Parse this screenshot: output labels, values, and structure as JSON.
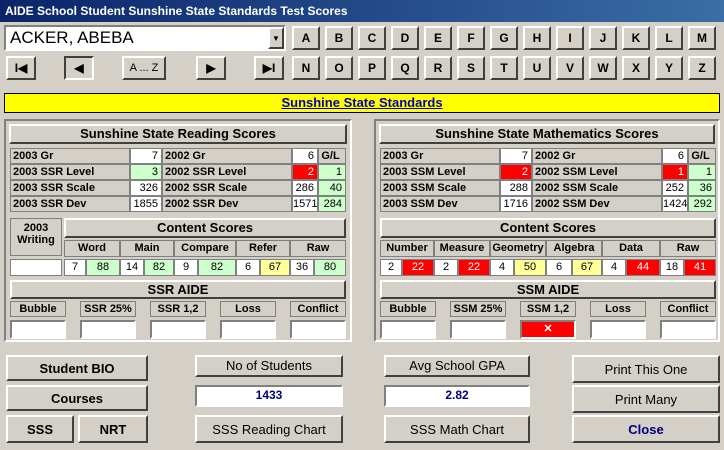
{
  "window": {
    "title": "AIDE School Student Sunshine State Standards Test Scores"
  },
  "student": {
    "name": "ACKER, ABEBA"
  },
  "letters_row1": [
    "A",
    "B",
    "C",
    "D",
    "E",
    "F",
    "G",
    "H",
    "I",
    "J",
    "K",
    "L",
    "M"
  ],
  "letters_row2": [
    "N",
    "O",
    "P",
    "Q",
    "R",
    "S",
    "T",
    "U",
    "V",
    "W",
    "X",
    "Y",
    "Z"
  ],
  "nav": {
    "first": "I◀",
    "prev": "◀",
    "range": "A ... Z",
    "next": "▶",
    "last": "▶I"
  },
  "banner": "Sunshine State Standards",
  "reading": {
    "title": "Sunshine State Reading Scores",
    "rows": [
      {
        "l1": "2003 Gr",
        "v1": "7",
        "l2": "2002 Gr",
        "v2": "6",
        "v3": "G/L"
      },
      {
        "l1": "2003 SSR Level",
        "v1": "3",
        "l2": "2002 SSR Level",
        "v2": "2",
        "v3": "1"
      },
      {
        "l1": "2003 SSR Scale",
        "v1": "326",
        "l2": "2002 SSR Scale",
        "v2": "286",
        "v3": "40"
      },
      {
        "l1": "2003 SSR Dev",
        "v1": "1855",
        "l2": "2002 SSR Dev",
        "v2": "1571",
        "v3": "284"
      }
    ],
    "writing_label": "2003 Writing",
    "content_title": "Content Scores",
    "content_cols": [
      "Word",
      "Main",
      "Compare",
      "Refer",
      "Raw"
    ],
    "content_vals": [
      "7",
      "88",
      "14",
      "82",
      "9",
      "82",
      "6",
      "67",
      "36",
      "80"
    ],
    "aide_title": "SSR AIDE",
    "aide_cols": [
      "Bubble",
      "SSR 25%",
      "SSR 1,2",
      "Loss",
      "Conflict"
    ]
  },
  "math": {
    "title": "Sunshine State Mathematics Scores",
    "rows": [
      {
        "l1": "2003 Gr",
        "v1": "7",
        "l2": "2002 Gr",
        "v2": "6",
        "v3": "G/L"
      },
      {
        "l1": "2003 SSM Level",
        "v1": "2",
        "l2": "2002 SSM Level",
        "v2": "1",
        "v3": "1"
      },
      {
        "l1": "2003 SSM Scale",
        "v1": "288",
        "l2": "2002 SSM Scale",
        "v2": "252",
        "v3": "36"
      },
      {
        "l1": "2003 SSM Dev",
        "v1": "1716",
        "l2": "2002 SSM Dev",
        "v2": "1424",
        "v3": "292"
      }
    ],
    "content_title": "Content Scores",
    "content_cols": [
      "Number",
      "Measure",
      "Geometry",
      "Algebra",
      "Data",
      "Raw"
    ],
    "content_vals": [
      "2",
      "22",
      "2",
      "22",
      "4",
      "50",
      "6",
      "67",
      "4",
      "44",
      "18",
      "41"
    ],
    "aide_title": "SSM AIDE",
    "aide_cols": [
      "Bubble",
      "SSM 25%",
      "SSM 1,2",
      "Loss",
      "Conflict"
    ],
    "aide_mark": "✕"
  },
  "bottom": {
    "student_bio": "Student BIO",
    "courses": "Courses",
    "sss": "SSS",
    "nrt": "NRT",
    "no_students_label": "No of Students",
    "no_students_value": "1433",
    "gpa_label": "Avg  School  GPA",
    "gpa_value": "2.82",
    "reading_chart": "SSS Reading Chart",
    "math_chart": "SSS Math Chart",
    "print_one": "Print This One",
    "print_many": "Print Many",
    "close": "Close"
  },
  "colors": {
    "title_bar": "#0a246a",
    "banner": "#ffff00",
    "good": "#ccffcc",
    "bad": "#ff0000",
    "mid": "#ffff99",
    "close_text": "#000080"
  }
}
